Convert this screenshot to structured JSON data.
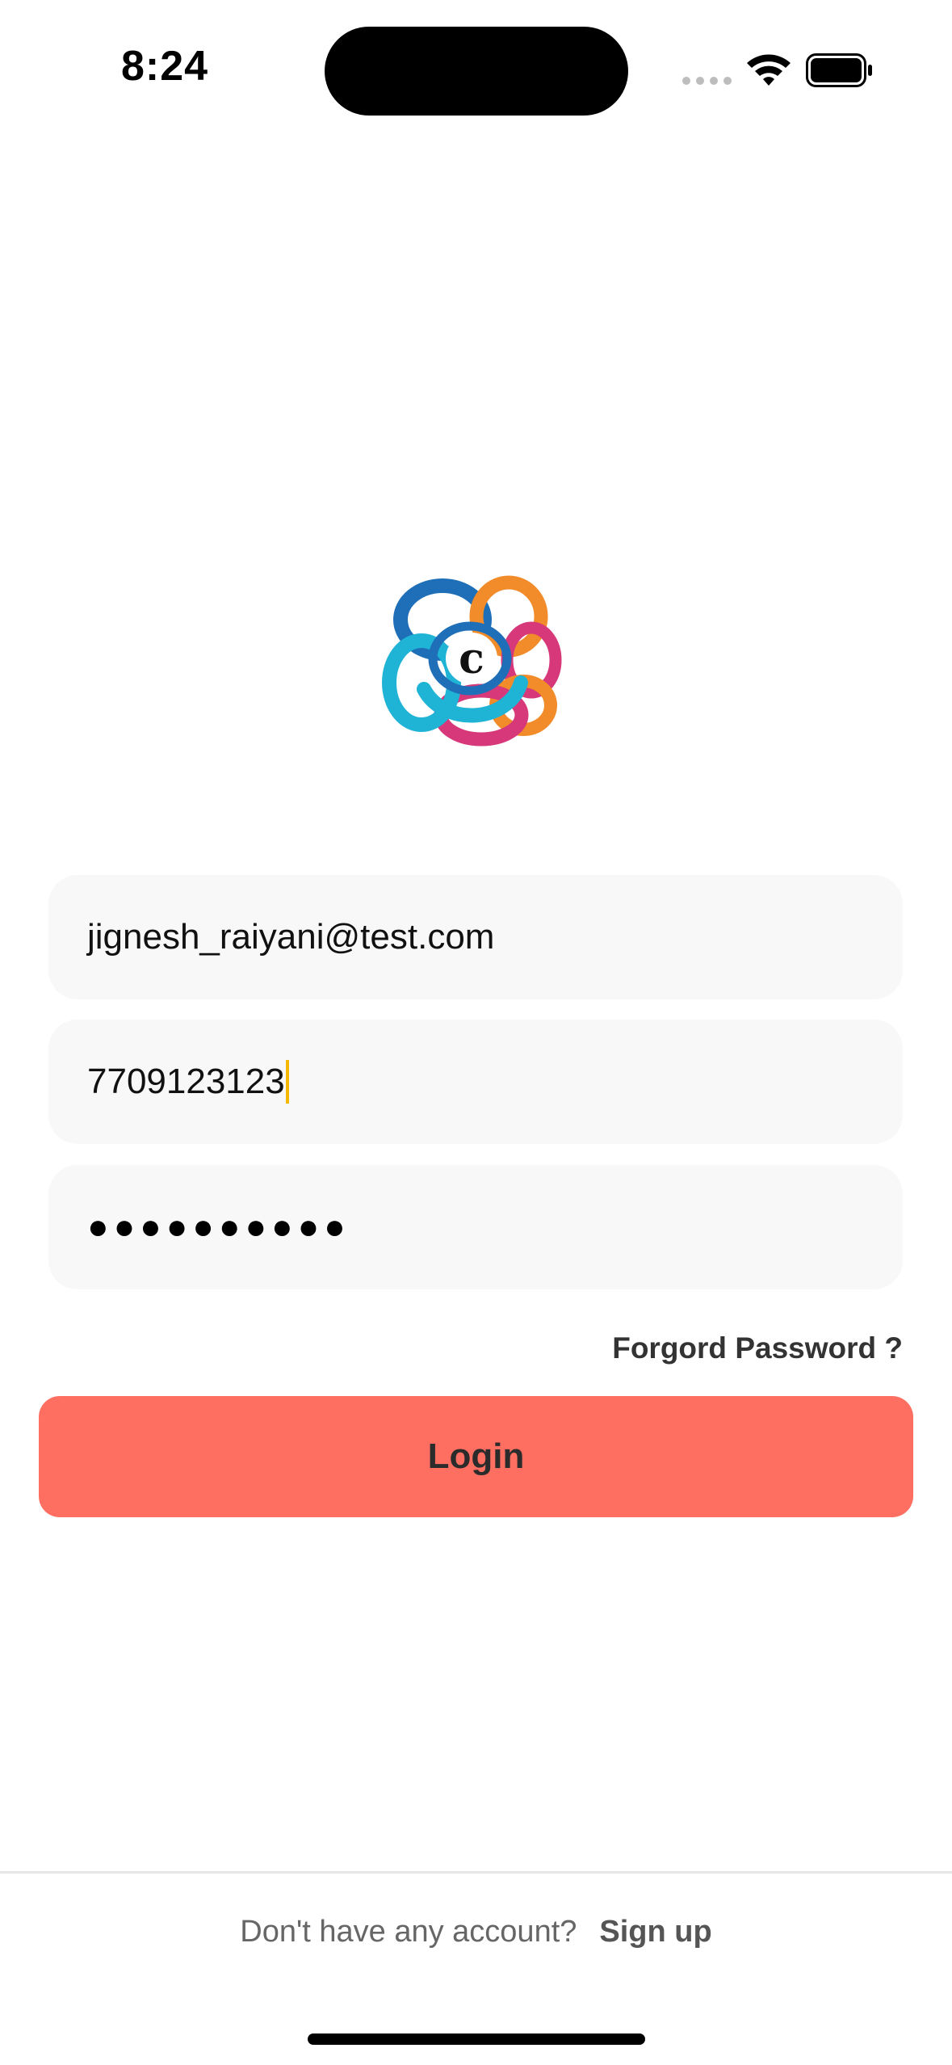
{
  "status_bar": {
    "time": "8:24",
    "signal_icon": "cellular-signal-icon",
    "wifi_icon": "wifi-icon",
    "battery_icon": "battery-icon"
  },
  "logo": {
    "letter": "c",
    "colors": {
      "blue": "#1f6fb8",
      "cyan": "#1fb3d6",
      "pink": "#d6387a",
      "orange": "#f28b2a"
    }
  },
  "form": {
    "email": {
      "value": "jignesh_raiyani@test.com"
    },
    "phone": {
      "value": "7709123123"
    },
    "password": {
      "masked_value": "●●●●●●●●●●"
    },
    "forgot_label": "Forgord Password ?",
    "login_label": "Login"
  },
  "footer": {
    "question": "Don't have any account?",
    "signup_label": "Sign up"
  },
  "colors": {
    "accent": "#ff6f61",
    "field_bg": "#f8f8f8",
    "caret": "#f5b800"
  }
}
